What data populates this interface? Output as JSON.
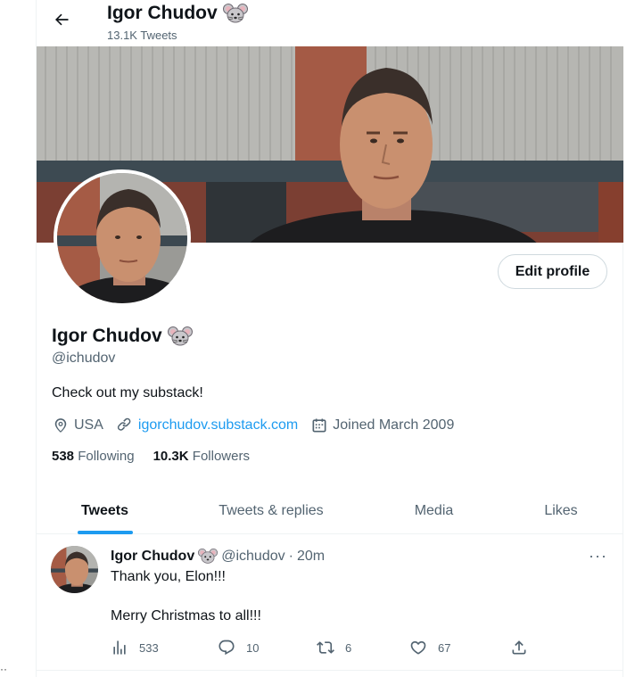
{
  "header": {
    "name": "Igor Chudov",
    "tweet_count": "13.1K Tweets"
  },
  "profile": {
    "name": "Igor Chudov",
    "handle": "@ichudov",
    "bio": "Check out my substack!",
    "location": "USA",
    "website": "igorchudov.substack.com",
    "joined": "Joined March 2009",
    "edit_label": "Edit profile",
    "following_count": "538",
    "following_label": "Following",
    "followers_count": "10.3K",
    "followers_label": "Followers"
  },
  "tabs": [
    {
      "label": "Tweets",
      "active": true
    },
    {
      "label": "Tweets & replies",
      "active": false
    },
    {
      "label": "Media",
      "active": false
    },
    {
      "label": "Likes",
      "active": false
    }
  ],
  "tweet": {
    "name": "Igor Chudov",
    "handle": "@ichudov",
    "separator": "·",
    "time": "20m",
    "line1": "Thank you, Elon!!!",
    "line2": "Merry Christmas to all!!!",
    "more": "···",
    "views": "533",
    "replies": "10",
    "retweets": "6",
    "likes": "67"
  },
  "colors": {
    "accent": "#1d9bf0",
    "secondary_text": "#536471",
    "primary_text": "#0f1419"
  },
  "edge_marks": "··"
}
